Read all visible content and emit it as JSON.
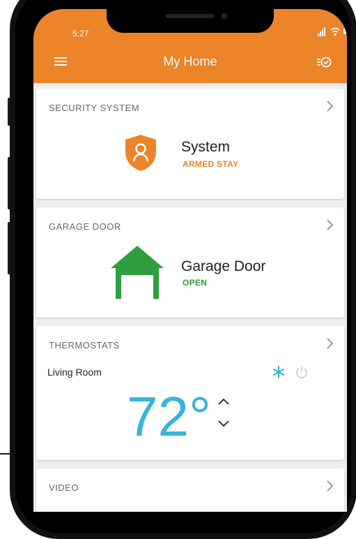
{
  "status_bar": {
    "time": "5:27"
  },
  "header": {
    "title": "My Home"
  },
  "security": {
    "section_title": "SECURITY SYSTEM",
    "name": "System",
    "status": "ARMED STAY",
    "status_color": "#ec842a"
  },
  "garage": {
    "section_title": "GARAGE DOOR",
    "name": "Garage Door",
    "status": "OPEN",
    "status_color": "#2e9e3e"
  },
  "thermostats": {
    "section_title": "THERMOSTATS",
    "room": "Living Room",
    "temperature": "72°",
    "mode_icon": "snowflake-icon"
  },
  "video": {
    "section_title": "VIDEO"
  },
  "colors": {
    "accent": "#ec842a",
    "open_green": "#2e9e3e",
    "thermo_blue": "#39b3dd"
  }
}
